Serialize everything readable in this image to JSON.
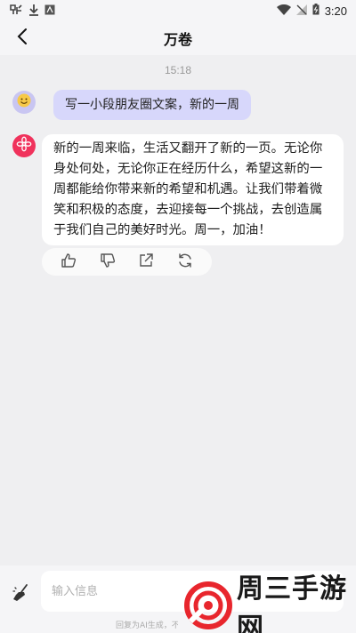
{
  "status_bar": {
    "time": "3:20",
    "icons": [
      "messenger-icon",
      "download-icon",
      "image-icon",
      "wifi-icon",
      "signal-off-icon",
      "battery-icon"
    ]
  },
  "header": {
    "title": "万卷",
    "back_icon": "back-chevron-icon"
  },
  "chat": {
    "timestamp": "15:18",
    "user_message": {
      "avatar_icon": "smiley-avatar",
      "text": "写一小段朋友圈文案，新的一周"
    },
    "ai_message": {
      "avatar_icon": "ai-flower-avatar",
      "text": "新的一周来临，生活又翻开了新的一页。无论你身处何处，无论你正在经历什么，希望这新的一周都能给你带来新的希望和机遇。让我们带着微笑和积极的态度，去迎接每一个挑战，去创造属于我们自己的美好时光。周一，加油！"
    },
    "actions": [
      "thumbs-up-icon",
      "thumbs-down-icon",
      "share-icon",
      "regenerate-icon"
    ]
  },
  "input": {
    "placeholder": "输入信息",
    "clean_icon": "broom-icon",
    "disclaimer": "回复为AI生成，不"
  },
  "watermark": {
    "text": "周三手游网"
  },
  "colors": {
    "background": "#efeff1",
    "user_bubble": "#d7d7fb",
    "ai_avatar": "#f0325c",
    "watermark_red": "#e8262d"
  }
}
